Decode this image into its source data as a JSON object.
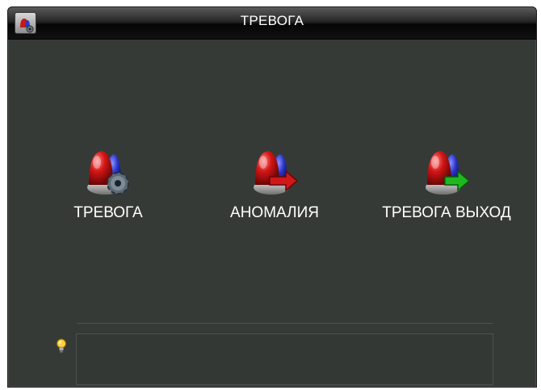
{
  "window": {
    "title": "ТРЕВОГА",
    "title_icon": "alarm-settings-icon"
  },
  "menu": {
    "items": [
      {
        "label": "ТРЕВОГА",
        "icon": "alarm-gear-icon",
        "accent": "#8a8f94"
      },
      {
        "label": "АНОМАЛИЯ",
        "icon": "alarm-red-arrow-icon",
        "accent": "#d01818"
      },
      {
        "label": "ТРЕВОГА ВЫХОД",
        "icon": "alarm-green-arrow-icon",
        "accent": "#1fb81f"
      }
    ]
  },
  "tip": {
    "icon": "lightbulb-icon",
    "text": ""
  },
  "colors": {
    "background": "#363a37",
    "siren_red": "#d31515",
    "siren_blue": "#2a34c8"
  }
}
